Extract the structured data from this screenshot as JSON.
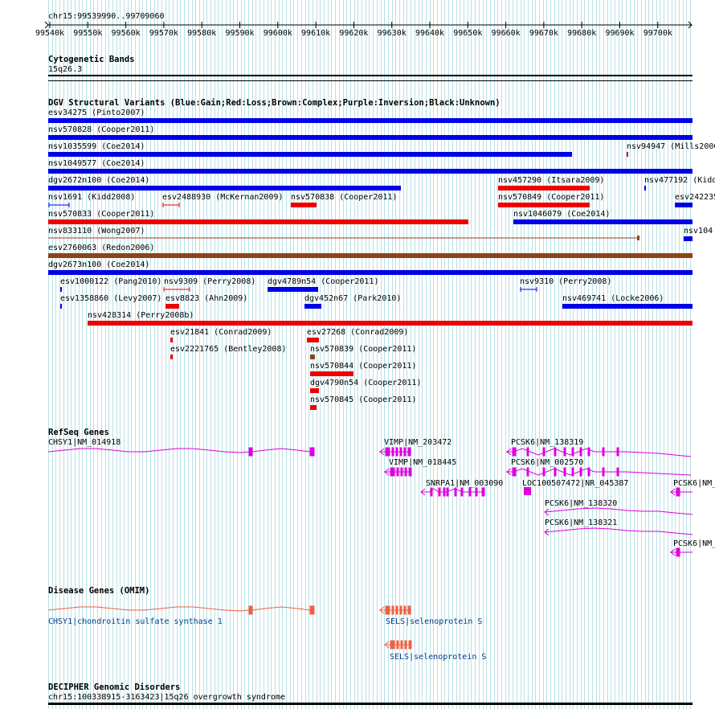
{
  "colors": {
    "gain": "#0000e6",
    "loss": "#ee0000",
    "complex": "#8b4513",
    "refseq": "#dd00dd",
    "omim": "#f06040",
    "omim_text": "#00408c",
    "grid": "#b9e0e6"
  },
  "ruler": {
    "position": "chr15:99539990..99709060",
    "ticks": [
      "99540k",
      "99550k",
      "99560k",
      "99570k",
      "99580k",
      "99590k",
      "99600k",
      "99610k",
      "99620k",
      "99630k",
      "99640k",
      "99650k",
      "99660k",
      "99670k",
      "99680k",
      "99690k",
      "99700k"
    ]
  },
  "cyto": {
    "title": "Cytogenetic Bands",
    "band": "15q26.3"
  },
  "dgv": {
    "title": "DGV Structural Variants (Blue:Gain;Red:Loss;Brown:Complex;Purple:Inversion;Black:Unknown)",
    "labels": [
      "esv34275 (Pinto2007)",
      "nsv570828 (Cooper2011)",
      "nsv1035599 (Coe2014)",
      "nsv94947 (Mills2006)",
      "nsv1049577 (Coe2014)",
      "dgv2672n100 (Coe2014)",
      "nsv457290 (Itsara2009)",
      "nsv477192 (Kidd",
      "nsv1691 (Kidd2008)",
      "esv2488930 (McKernan2009)",
      "nsv570838 (Cooper2011)",
      "nsv570849 (Cooper2011)",
      "esv242235",
      "nsv570833 (Cooper2011)",
      "nsv1046079 (Coe2014)",
      "nsv833110 (Wong2007)",
      "nsv104",
      "esv2760063 (Redon2006)",
      "dgv2673n100 (Coe2014)",
      "esv1000122 (Pang2010)",
      "nsv9309 (Perry2008)",
      "dgv4789n54 (Cooper2011)",
      "nsv9310 (Perry2008)",
      "esv1358860 (Levy2007)",
      "esv8823 (Ahn2009)",
      "dgv452n67 (Park2010)",
      "nsv469741 (Locke2006)",
      "nsv428314 (Perry2008b)",
      "esv21841 (Conrad2009)",
      "esv27268 (Conrad2009)",
      "esv2221765 (Bentley2008)",
      "nsv570839 (Cooper2011)",
      "nsv570844 (Cooper2011)",
      "dgv4790n54 (Cooper2011)",
      "nsv570845 (Cooper2011)"
    ]
  },
  "refseq": {
    "title": "RefSeq Genes",
    "labels": [
      "CHSY1|NM_014918",
      "VIMP|NM_203472",
      "PCSK6|NM_138319",
      "VIMP|NM_018445",
      "PCSK6|NM_002570",
      "SNRPA1|NM_003090",
      "LOC100507472|NR_045387",
      "PCSK6|NM_",
      "PCSK6|NM_138320",
      "PCSK6|NM_138321",
      "PCSK6|NM_"
    ]
  },
  "omim": {
    "title": "Disease Genes (OMIM)",
    "labels": [
      "CHSY1|chondroitin sulfate synthase 1",
      "SELS|selenoprotein S",
      "SELS|selenoprotein S"
    ]
  },
  "decipher": {
    "title": "DECIPHER Genomic Disorders",
    "label": "chr15:100338915-3163423|15q26 overgrowth syndrome"
  }
}
